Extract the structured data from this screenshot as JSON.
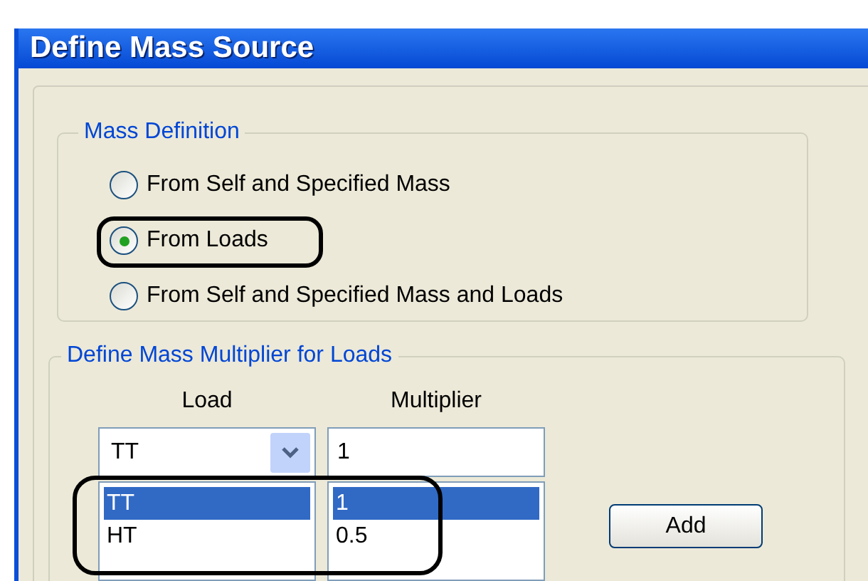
{
  "window": {
    "title": "Define Mass Source"
  },
  "mass_definition": {
    "title": "Mass Definition",
    "options": [
      {
        "label": "From Self and Specified Mass",
        "selected": false,
        "circled": false
      },
      {
        "label": "From Loads",
        "selected": true,
        "circled": true
      },
      {
        "label": "From Self and Specified Mass and Loads",
        "selected": false,
        "circled": false
      }
    ]
  },
  "multipliers": {
    "title": "Define Mass Multiplier for Loads",
    "load_header": "Load",
    "multiplier_header": "Multiplier",
    "load_value": "TT",
    "multiplier_value": "1",
    "lists_circled": true,
    "rows": [
      {
        "load": "TT",
        "multiplier": "1",
        "selected": true
      },
      {
        "load": "HT",
        "multiplier": "0.5",
        "selected": false
      }
    ],
    "add_button": "Add"
  }
}
